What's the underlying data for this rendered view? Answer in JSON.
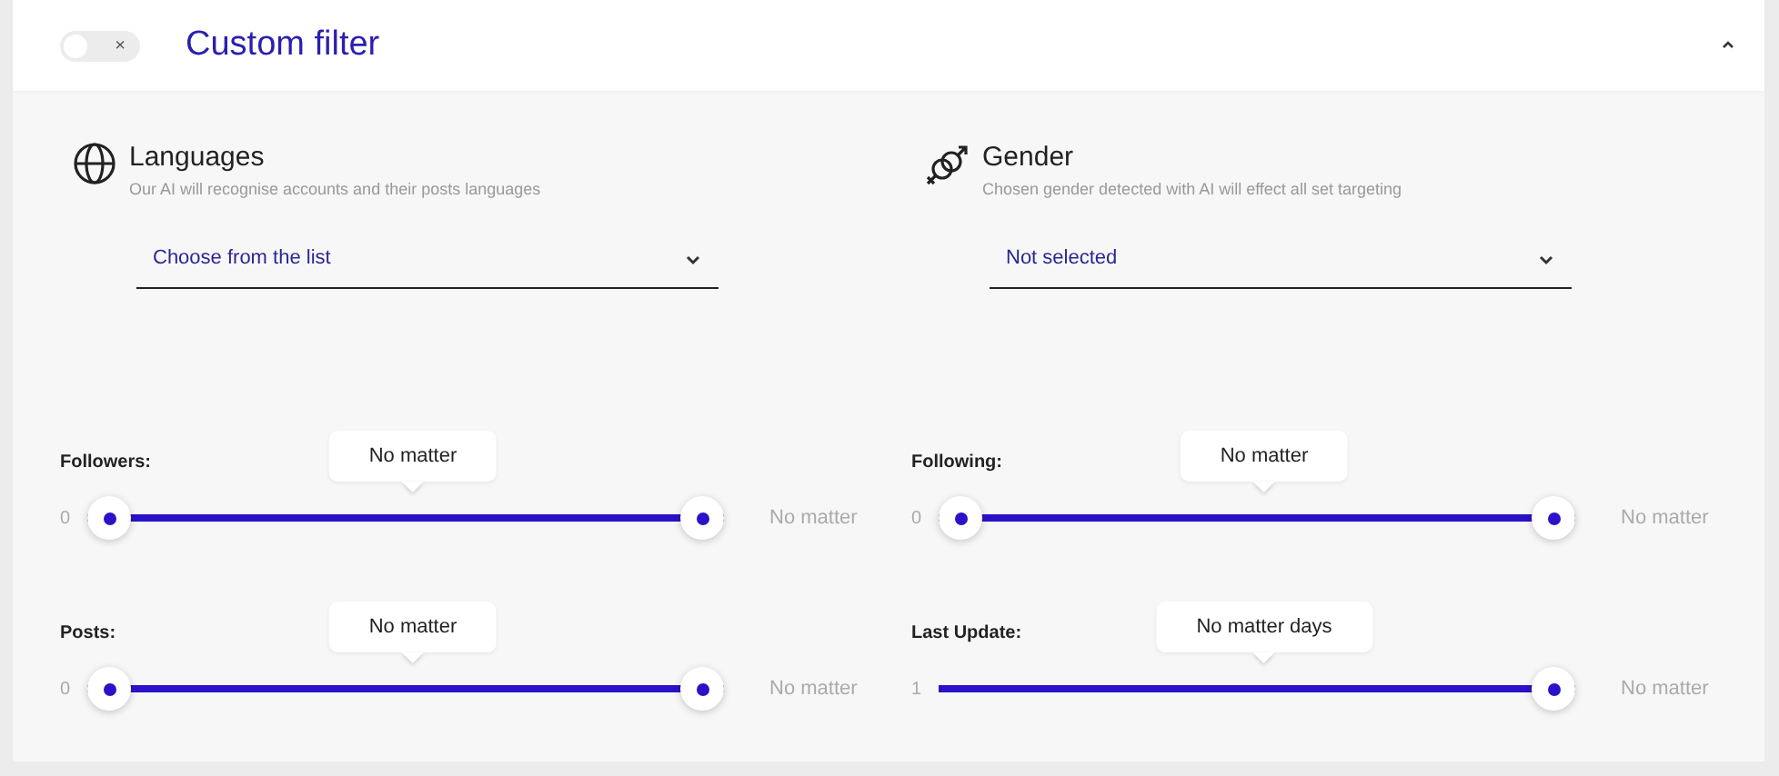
{
  "header": {
    "toggle": {
      "on": false,
      "off_mark": "×"
    },
    "title": "Custom filter",
    "expanded": true
  },
  "selects": [
    {
      "kind": "globe",
      "title": "Languages",
      "subtitle": "Our AI will recognise accounts and their posts languages",
      "value": "Choose from the list"
    },
    {
      "kind": "gender",
      "title": "Gender",
      "subtitle": "Chosen gender detected with AI will effect all set targeting",
      "value": "Not selected"
    }
  ],
  "sliders": [
    {
      "label": "Followers:",
      "kind": "range",
      "min_label": "0",
      "max_label": "No matter",
      "tooltip": "No matter",
      "level": 1
    },
    {
      "label": "Following:",
      "kind": "range",
      "min_label": "0",
      "max_label": "No matter",
      "tooltip": "No matter",
      "level": 1
    },
    {
      "label": "Posts:",
      "kind": "range",
      "min_label": "0",
      "max_label": "No matter",
      "tooltip": "No matter",
      "level": 1
    },
    {
      "label": "Last Update:",
      "kind": "single",
      "min_label": "1",
      "max_label": "No matter",
      "tooltip": "No matter days",
      "level": 1
    }
  ]
}
